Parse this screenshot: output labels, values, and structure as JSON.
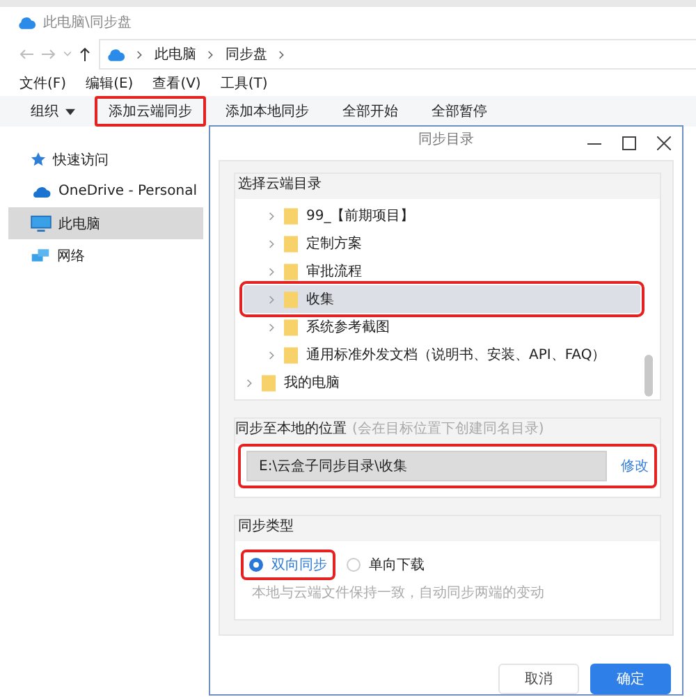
{
  "window": {
    "title": "此电脑\\同步盘"
  },
  "address_bar": {
    "crumbs": [
      "此电脑",
      "同步盘"
    ]
  },
  "menu": [
    "文件(F)",
    "编辑(E)",
    "查看(V)",
    "工具(T)"
  ],
  "toolbar": [
    {
      "label": "组织",
      "kind": "dropdown",
      "highlighted": false
    },
    {
      "label": "添加云端同步",
      "kind": "button",
      "highlighted": true
    },
    {
      "label": "添加本地同步",
      "kind": "button",
      "highlighted": false
    },
    {
      "label": "全部开始",
      "kind": "button",
      "highlighted": false
    },
    {
      "label": "全部暂停",
      "kind": "button",
      "highlighted": false
    }
  ],
  "sidebar": {
    "items": [
      {
        "label": "快速访问",
        "kind": "star",
        "selected": false
      },
      {
        "label": "OneDrive - Personal",
        "kind": "cloud",
        "selected": false
      },
      {
        "label": "此电脑",
        "kind": "computer",
        "selected": true
      },
      {
        "label": "网络",
        "kind": "network",
        "selected": false
      }
    ]
  },
  "dialog": {
    "title": "同步目录",
    "cloud_section": {
      "legend": "选择云端目录",
      "tree": {
        "nested_items": [
          {
            "label": "99_【前期项目】",
            "selected": false,
            "highlighted": false
          },
          {
            "label": "定制方案",
            "selected": false,
            "highlighted": false
          },
          {
            "label": "审批流程",
            "selected": false,
            "highlighted": false
          },
          {
            "label": "收集",
            "selected": true,
            "highlighted": true
          },
          {
            "label": "系统参考截图",
            "selected": false,
            "highlighted": false
          },
          {
            "label": "通用标准外发文档（说明书、安装、API、FAQ）",
            "selected": false,
            "highlighted": false
          }
        ],
        "top_items": [
          {
            "label": "我的电脑",
            "selected": false
          }
        ]
      }
    },
    "local_section": {
      "legend": "同步至本地的位置",
      "hint": "(会在目标位置下创建同名目录)",
      "path": "E:\\云盒子同步目录\\收集",
      "change_link": "修改",
      "highlighted": true
    },
    "type_section": {
      "legend": "同步类型",
      "options": [
        {
          "label": "双向同步",
          "selected": true,
          "highlighted": true
        },
        {
          "label": "单向下载",
          "selected": false,
          "highlighted": false
        }
      ],
      "description": "本地与云端文件保持一致，自动同步两端的变动"
    },
    "buttons": [
      {
        "label": "取消",
        "kind": "secondary"
      },
      {
        "label": "确定",
        "kind": "primary"
      }
    ]
  }
}
